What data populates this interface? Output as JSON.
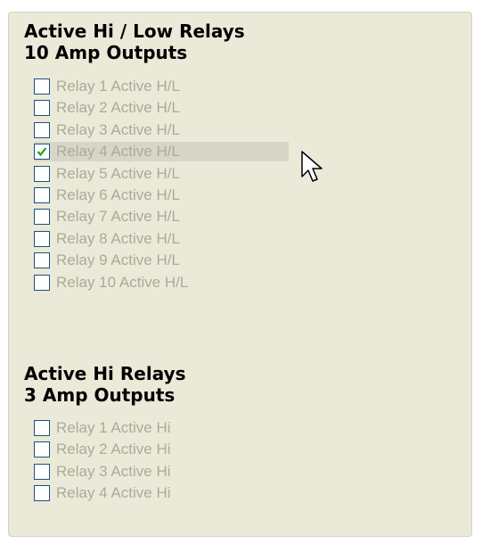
{
  "group1": {
    "title_line1": "Active Hi / Low Relays",
    "title_line2": "10 Amp Outputs",
    "items": [
      {
        "label": "Relay 1 Active H/L",
        "checked": false
      },
      {
        "label": "Relay 2 Active H/L",
        "checked": false
      },
      {
        "label": "Relay 3 Active H/L",
        "checked": false
      },
      {
        "label": "Relay 4 Active H/L",
        "checked": true
      },
      {
        "label": "Relay 5 Active H/L",
        "checked": false
      },
      {
        "label": "Relay 6 Active H/L",
        "checked": false
      },
      {
        "label": "Relay 7 Active H/L",
        "checked": false
      },
      {
        "label": "Relay 8 Active H/L",
        "checked": false
      },
      {
        "label": "Relay 9 Active H/L",
        "checked": false
      },
      {
        "label": "Relay 10 Active H/L",
        "checked": false
      }
    ]
  },
  "group2": {
    "title_line1": "Active Hi Relays",
    "title_line2": "3 Amp Outputs",
    "items": [
      {
        "label": "Relay 1 Active Hi",
        "checked": false
      },
      {
        "label": "Relay 2 Active Hi",
        "checked": false
      },
      {
        "label": "Relay 3 Active Hi",
        "checked": false
      },
      {
        "label": "Relay 4 Active Hi",
        "checked": false
      }
    ]
  },
  "colors": {
    "panel_bg": "#ebe9d8",
    "disabled_text": "#acaa99",
    "checkbox_border": "#1c5180",
    "checkmark": "#21a121",
    "hover_highlight": "#d8d6c8"
  },
  "icons": {
    "checkmark": "checkmark-icon",
    "cursor": "mouse-pointer-icon"
  }
}
